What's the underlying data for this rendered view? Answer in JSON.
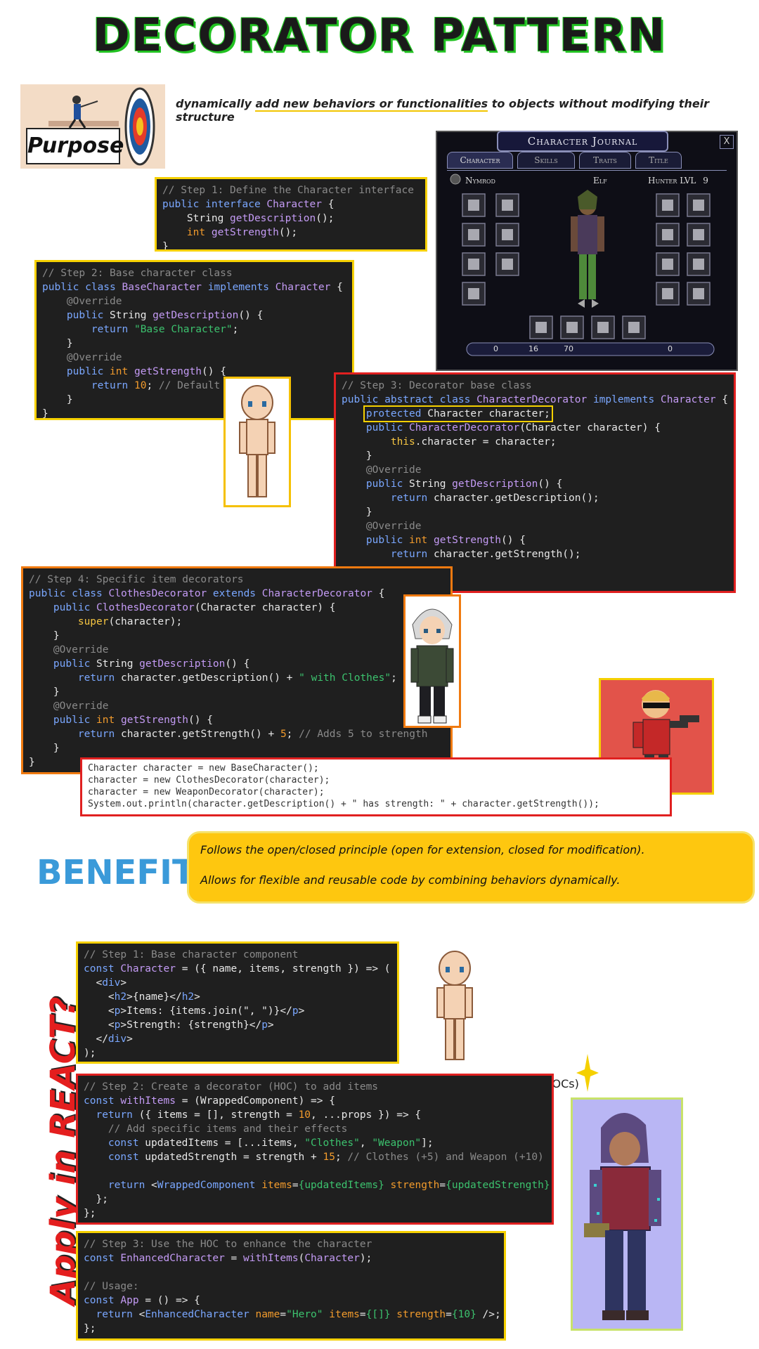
{
  "title": "DECORATOR PATTERN",
  "purpose": {
    "label": "Purpose",
    "text_1": "dynamically ",
    "text_u": "add new behaviors or functionalities",
    "text_2": " to objects without modifying their structure"
  },
  "journal": {
    "title": "Character Journal",
    "tabs": [
      "Character",
      "Skills",
      "Traits",
      "Title"
    ],
    "name": "Nymrod",
    "race": "Elf",
    "class_level": "Hunter LVL",
    "level": "9",
    "stats": [
      "0",
      "16",
      "70",
      "0"
    ],
    "close": "X"
  },
  "step1_title": "// Step 1: Define the Character interface",
  "step2_title": "// Step 2: Base character class",
  "step3_title": "// Step 3: Decorator base class",
  "step4_title": "// Step 4: Specific item decorators",
  "usage_lines": [
    "Character character = new BaseCharacter();",
    "character = new ClothesDecorator(character);",
    "character = new WeaponDecorator(character);",
    "System.out.println(character.getDescription() + \" has strength: \" + character.getStrength());"
  ],
  "benefits": {
    "label": "BENEFITS",
    "items": [
      "Follows the open/closed principle (open for extension, closed for modification).",
      "Allows for flexible and reusable code by combining behaviors dynamically."
    ]
  },
  "apply_title": "Apply in REACT?",
  "hoc_label": "Higher-Order Components (HOCs)",
  "react_step1_title": "// Step 1: Base character component",
  "react_step2_title": "// Step 2: Create a decorator (HOC) to add items",
  "react_step3_title": "// Step 3: Use the HOC to enhance the character",
  "react_usage_comment": "// Usage:",
  "colors": {
    "title_outline": "#22c222",
    "code_bg": "#1f1f1f",
    "yellow_border": "#f5d000",
    "red_border": "#e02020",
    "orange_border": "#f07a10",
    "benefits_bg": "#fec70f",
    "apply_red": "#e41e1e"
  }
}
